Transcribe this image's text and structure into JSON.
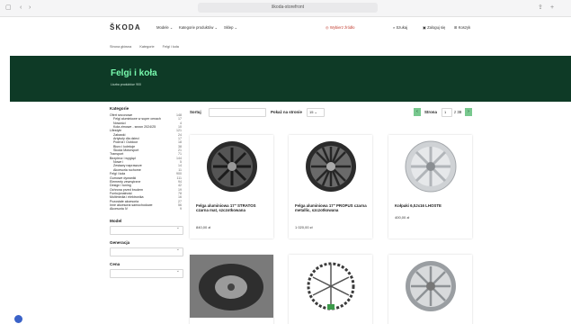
{
  "browser": {
    "url": "škoda-storefront",
    "back": "‹",
    "forward": "›",
    "tabs_icon": "▢",
    "share_icon": "⇪",
    "new_tab": "+"
  },
  "header": {
    "logo": "ŠKODA",
    "nav": [
      "Modele ⌄",
      "Kategorie produktów ⌄",
      "Sklep ⌄"
    ],
    "search_hint": "Wybierz źródło",
    "account": "Szukaj",
    "login": "Zaloguj się",
    "cart": "Koszyk"
  },
  "breadcrumb": [
    "Strona główna",
    "Kategorie",
    "Felgi i koła"
  ],
  "hero": {
    "title": "Felgi i koła",
    "subtitle": "Liczba produktów: 900"
  },
  "sidebar": {
    "heading": "Kategorie",
    "categories": [
      {
        "label": "Ofert sezonowe",
        "count": "148",
        "level": 1
      },
      {
        "label": "Felgi aluminiowe w super cenach",
        "count": "17",
        "level": 2
      },
      {
        "label": "Nowości",
        "count": "4",
        "level": 2
      },
      {
        "label": "Koła zimowe - sezon 2024/25",
        "count": "10",
        "level": 2
      },
      {
        "label": "Lifestyle",
        "count": "121",
        "level": 1
      },
      {
        "label": "Zabawki",
        "count": "24",
        "level": 2
      },
      {
        "label": "Artykuły dla dzieci",
        "count": "17",
        "level": 2
      },
      {
        "label": "Podróż i Outdoor",
        "count": "18",
        "level": 2
      },
      {
        "label": "Biuro i kolekcje",
        "count": "38",
        "level": 2
      },
      {
        "label": "Skoda Motorsport",
        "count": "21",
        "level": 2
      },
      {
        "label": "Transport",
        "count": "71",
        "level": 1
      },
      {
        "label": "Bezpiecz i wygląd",
        "count": "144",
        "level": 1
      },
      {
        "label": "Nowe i",
        "count": "5",
        "level": 2
      },
      {
        "label": "Zestawy naprawcze",
        "count": "14",
        "level": 2
      },
      {
        "label": "Akcesoria ruchome",
        "count": "11",
        "level": 2
      },
      {
        "label": "Felgi i koła",
        "count": "900",
        "level": 1
      },
      {
        "label": "Gumowe dywaniki",
        "count": "111",
        "level": 1
      },
      {
        "label": "Elementy zewnętrzne",
        "count": "94",
        "level": 1
      },
      {
        "label": "Design i tuning",
        "count": "42",
        "level": 1
      },
      {
        "label": "Ochrona przed brudem",
        "count": "19",
        "level": 1
      },
      {
        "label": "Funkcjonalność",
        "count": "78",
        "level": 1
      },
      {
        "label": "Multimedia i elektronika",
        "count": "16",
        "level": 1
      },
      {
        "label": "Pozostałe akcesoria",
        "count": "27",
        "level": 1
      },
      {
        "label": "Inne akcesoria samochodowe",
        "count": "56",
        "level": 1
      },
      {
        "label": "Akcesoria iV",
        "count": "9",
        "level": 1
      }
    ],
    "filters": [
      "Model",
      "Generacja",
      "Cena"
    ]
  },
  "toolbar": {
    "sort_label": "Sortuj",
    "per_page_label": "Pokaż na stronie",
    "per_page_value": "15 ⌄",
    "page_label": "Strona",
    "page_value": "1",
    "page_total": "z 38",
    "prev": "‹",
    "next": "›"
  },
  "products": [
    {
      "title": "Felga aluminiowa 17\" STRATOS czarna mat, szczotkowana",
      "price": "840,00 zł",
      "image": "dark-alloy-wheel"
    },
    {
      "title": "Felga aluminiowa 17\" PROPUS czarna metallic, szczotkowana",
      "price": "1 020,00 zł",
      "image": "dark-alloy-wheel"
    },
    {
      "title": "Kołpaki 6,0Jx16 LHOSTE",
      "price": "400,00 zł",
      "image": "silver-hubcap"
    },
    {
      "title": "",
      "price": "",
      "image": "spare-wheel-trunk"
    },
    {
      "title": "",
      "price": "",
      "image": "snow-chains"
    },
    {
      "title": "",
      "price": "",
      "image": "silver-alloy-wheel"
    }
  ],
  "colors": {
    "hero": "#0e3a26",
    "accent": "#78faae",
    "button": "#78c88e"
  }
}
